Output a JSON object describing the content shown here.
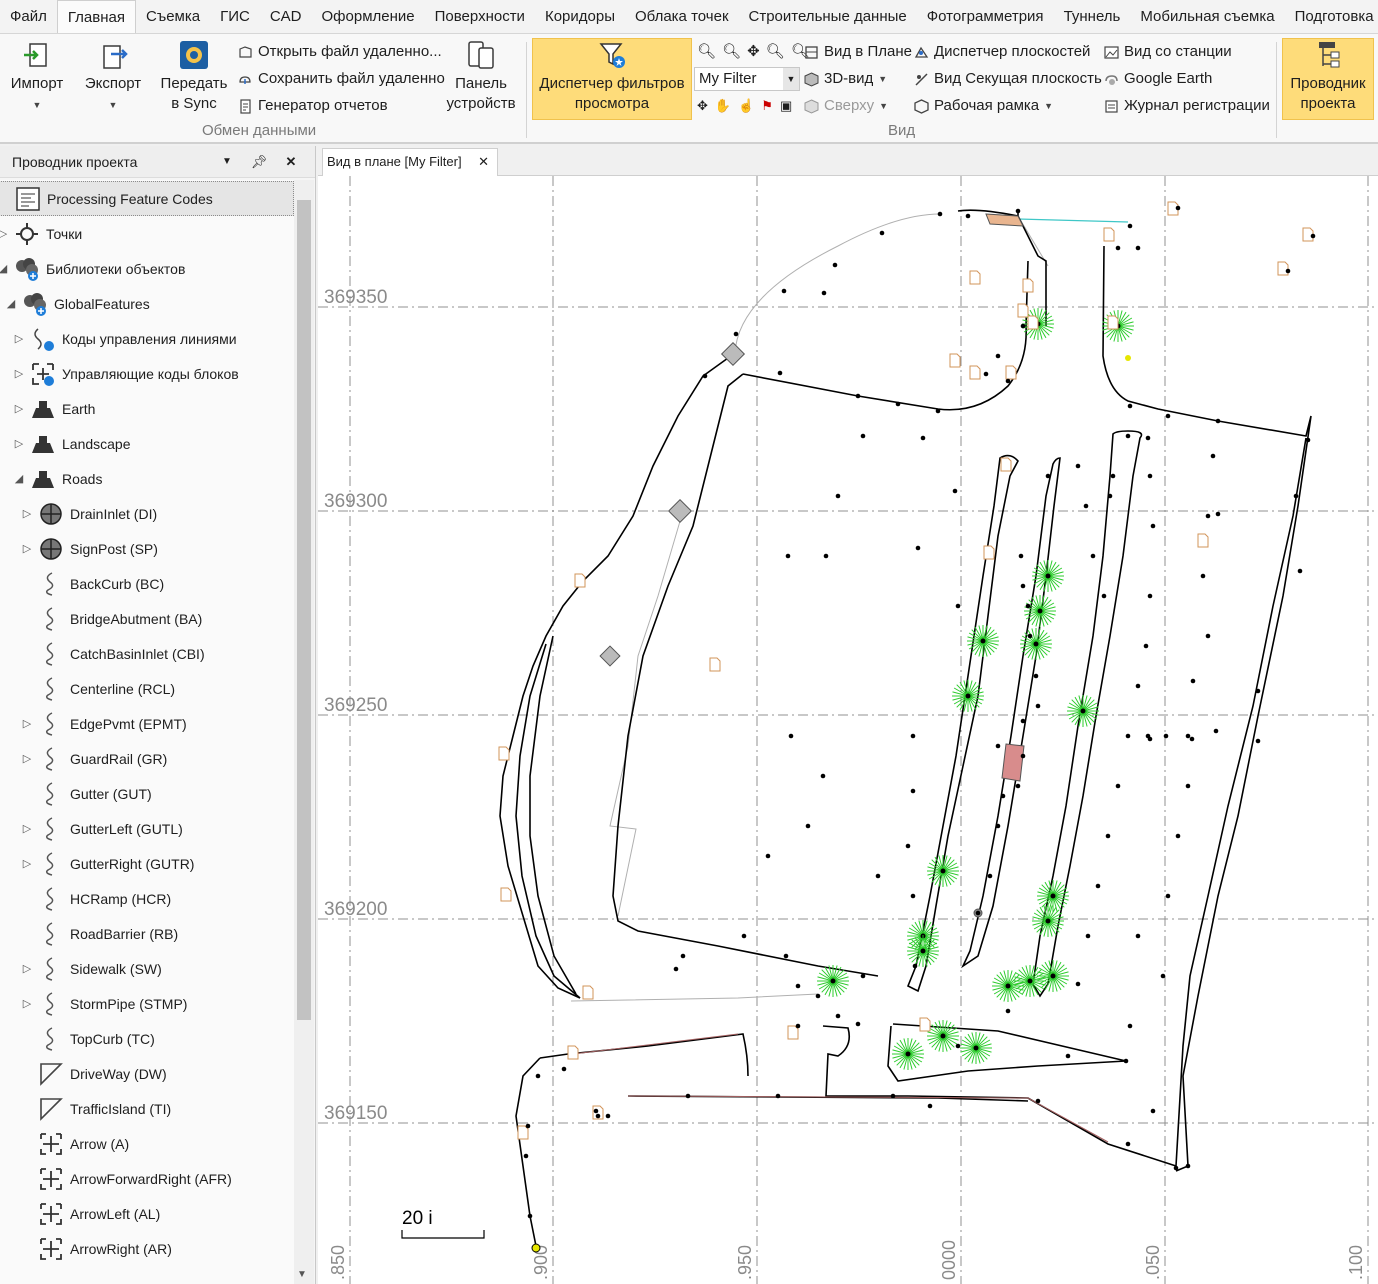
{
  "menu": {
    "tabs": [
      "Файл",
      "Главная",
      "Съемка",
      "ГИС",
      "CAD",
      "Оформление",
      "Поверхности",
      "Коридоры",
      "Облака точек",
      "Строительные данные",
      "Фотограмметрия",
      "Туннель",
      "Мобильная съемка",
      "Подготовка"
    ],
    "active_index": 1
  },
  "ribbon": {
    "import_label": "Импорт",
    "export_label": "Экспорт",
    "sync_label_1": "Передать",
    "sync_label_2": "в Sync",
    "open_remote": "Открыть файл удаленно...",
    "save_remote": "Сохранить файл удаленно",
    "report_gen": "Генератор отчетов",
    "devices_1": "Панель",
    "devices_2": "устройств",
    "group_exchange": "Обмен данными",
    "filter_manager_1": "Диспетчер фильтров",
    "filter_manager_2": "просмотра",
    "filter_value": "My Filter",
    "plan_view": "Вид в Плане",
    "view_3d": "3D-вид",
    "top_view": "Сверху",
    "plane_manager": "Диспетчер плоскостей",
    "section_plane": "Вид Секущая плоскость",
    "work_frame": "Рабочая рамка",
    "station_view": "Вид со станции",
    "google_earth": "Google Earth",
    "log": "Журнал регистрации",
    "group_view": "Вид",
    "explorer_1": "Проводник",
    "explorer_2": "проекта"
  },
  "explorer": {
    "title": "Проводник проекта",
    "items": [
      {
        "label": "Processing Feature Codes",
        "indent": 0,
        "exp": "",
        "icon": "feature-codes-icon"
      },
      {
        "label": "Точки",
        "indent": 0,
        "exp": "▷",
        "icon": "points-icon"
      },
      {
        "label": "Библиотеки объектов",
        "indent": 0,
        "exp": "◢",
        "icon": "library-icon"
      },
      {
        "label": "GlobalFeatures",
        "indent": 1,
        "exp": "◢",
        "icon": "library-icon"
      },
      {
        "label": "Коды управления линиями",
        "indent": 2,
        "exp": "▷",
        "icon": "line-code-icon"
      },
      {
        "label": "Управляющие коды блоков",
        "indent": 2,
        "exp": "▷",
        "icon": "block-code-icon"
      },
      {
        "label": "Earth",
        "indent": 2,
        "exp": "▷",
        "icon": "category-icon"
      },
      {
        "label": "Landscape",
        "indent": 2,
        "exp": "▷",
        "icon": "category-icon"
      },
      {
        "label": "Roads",
        "indent": 2,
        "exp": "◢",
        "icon": "category-icon"
      },
      {
        "label": "DrainInlet (DI)",
        "indent": 3,
        "exp": "▷",
        "icon": "point-feature-icon"
      },
      {
        "label": "SignPost (SP)",
        "indent": 3,
        "exp": "▷",
        "icon": "point-feature-icon"
      },
      {
        "label": "BackCurb (BC)",
        "indent": 3,
        "exp": "",
        "icon": "line-feature-icon"
      },
      {
        "label": "BridgeAbutment (BA)",
        "indent": 3,
        "exp": "",
        "icon": "line-feature-icon"
      },
      {
        "label": "CatchBasinInlet (CBI)",
        "indent": 3,
        "exp": "",
        "icon": "line-feature-icon"
      },
      {
        "label": "Centerline (RCL)",
        "indent": 3,
        "exp": "",
        "icon": "line-feature-icon"
      },
      {
        "label": "EdgePvmt (EPMT)",
        "indent": 3,
        "exp": "▷",
        "icon": "line-feature-icon"
      },
      {
        "label": "GuardRail (GR)",
        "indent": 3,
        "exp": "▷",
        "icon": "line-feature-icon"
      },
      {
        "label": "Gutter (GUT)",
        "indent": 3,
        "exp": "",
        "icon": "line-feature-icon"
      },
      {
        "label": "GutterLeft (GUTL)",
        "indent": 3,
        "exp": "▷",
        "icon": "line-feature-icon"
      },
      {
        "label": "GutterRight (GUTR)",
        "indent": 3,
        "exp": "▷",
        "icon": "line-feature-icon"
      },
      {
        "label": "HCRamp (HCR)",
        "indent": 3,
        "exp": "",
        "icon": "line-feature-icon"
      },
      {
        "label": "RoadBarrier (RB)",
        "indent": 3,
        "exp": "",
        "icon": "line-feature-icon"
      },
      {
        "label": "Sidewalk (SW)",
        "indent": 3,
        "exp": "▷",
        "icon": "line-feature-icon"
      },
      {
        "label": "StormPipe (STMP)",
        "indent": 3,
        "exp": "▷",
        "icon": "line-feature-icon"
      },
      {
        "label": "TopCurb (TC)",
        "indent": 3,
        "exp": "",
        "icon": "line-feature-icon"
      },
      {
        "label": "DriveWay (DW)",
        "indent": 3,
        "exp": "",
        "icon": "polygon-feature-icon"
      },
      {
        "label": "TrafficIsland (TI)",
        "indent": 3,
        "exp": "",
        "icon": "polygon-feature-icon"
      },
      {
        "label": "Arrow (A)",
        "indent": 3,
        "exp": "",
        "icon": "block-feature-icon"
      },
      {
        "label": "ArrowForwardRight (AFR)",
        "indent": 3,
        "exp": "",
        "icon": "block-feature-icon"
      },
      {
        "label": "ArrowLeft (AL)",
        "indent": 3,
        "exp": "",
        "icon": "block-feature-icon"
      },
      {
        "label": "ArrowRight (AR)",
        "indent": 3,
        "exp": "",
        "icon": "block-feature-icon"
      }
    ]
  },
  "document": {
    "tab_label": "Вид в плане [My Filter]"
  },
  "map": {
    "y_labels": [
      "369350",
      "369300",
      "369250",
      "369200",
      "369150"
    ],
    "x_labels": [
      ".850",
      ".900",
      ".950",
      "0000",
      ".050",
      ".100"
    ],
    "scale_label": "20 i",
    "colors": {
      "grid": "#909090",
      "line": "#000000",
      "tree": "#2ecc2e",
      "building": "#d88c8c",
      "road_edge": "#a36060",
      "cyan_line": "#3fc7c7"
    }
  }
}
